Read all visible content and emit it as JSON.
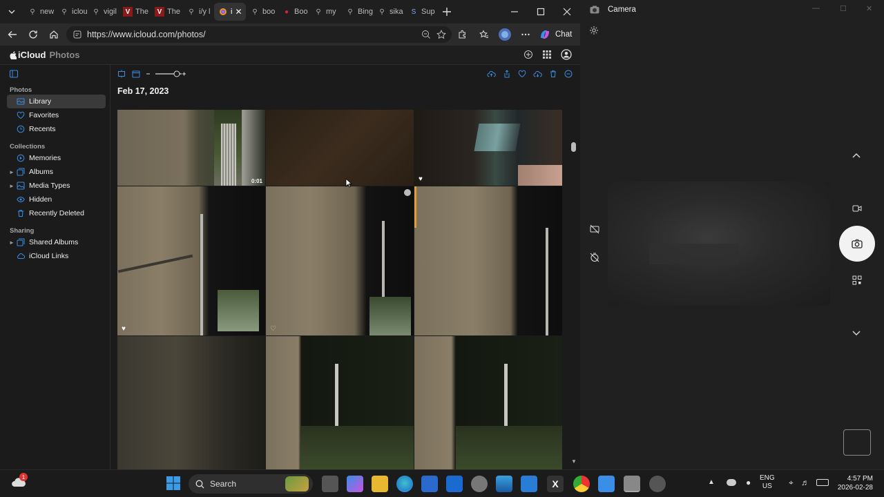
{
  "browser": {
    "tabs": [
      {
        "label": "new"
      },
      {
        "label": "iclou"
      },
      {
        "label": "vigil"
      },
      {
        "label": "The"
      },
      {
        "label": "The"
      },
      {
        "label": "i/y l"
      },
      {
        "label": "i"
      },
      {
        "label": "boo"
      },
      {
        "label": "Boo"
      },
      {
        "label": "my"
      },
      {
        "label": "Bing"
      },
      {
        "label": "sika"
      },
      {
        "label": "Sup"
      }
    ],
    "url": "https://www.icloud.com/photos/",
    "chat_label": "Chat"
  },
  "icloud": {
    "brand": "iCloud",
    "app": "Photos",
    "date_header": "Feb 17, 2023",
    "video_duration": "0:01",
    "sidebar": {
      "photos_section": "Photos",
      "photos_items": [
        {
          "label": "Library"
        },
        {
          "label": "Favorites"
        },
        {
          "label": "Recents"
        }
      ],
      "collections_section": "Collections",
      "collections_items": [
        {
          "label": "Memories"
        },
        {
          "label": "Albums"
        },
        {
          "label": "Media Types"
        },
        {
          "label": "Hidden"
        },
        {
          "label": "Recently Deleted"
        }
      ],
      "sharing_section": "Sharing",
      "sharing_items": [
        {
          "label": "Shared Albums"
        },
        {
          "label": "iCloud Links"
        }
      ]
    }
  },
  "camera": {
    "title": "Camera"
  },
  "taskbar": {
    "search_label": "Search",
    "language": "ENG",
    "region": "US",
    "time": "4:57 PM",
    "date": "2026-02-28",
    "notification_count": "1"
  },
  "colors": {
    "accent": "#3a8ee6",
    "edge_blue": "#2a7dd4"
  }
}
